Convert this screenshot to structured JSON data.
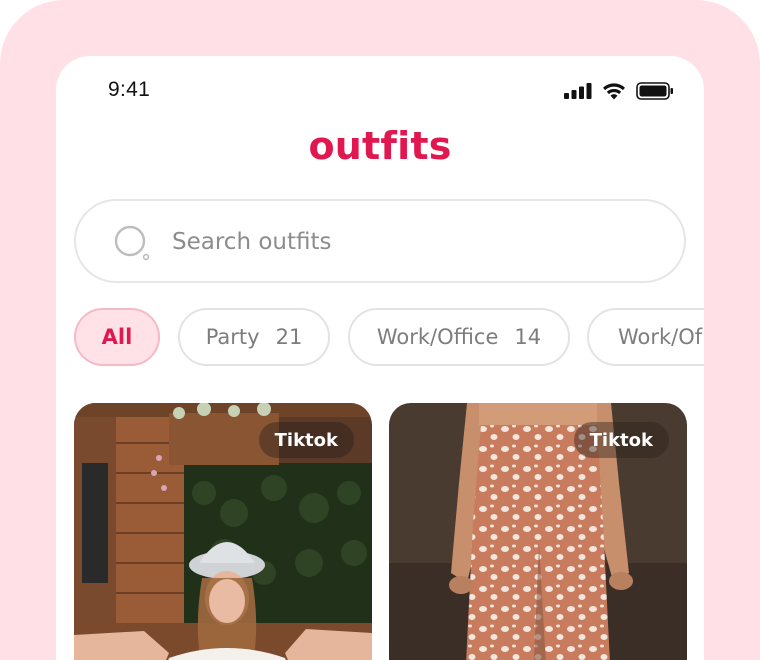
{
  "status_bar": {
    "time": "9:41"
  },
  "app": {
    "title": "outfits"
  },
  "search": {
    "placeholder": "Search outfits"
  },
  "filters": [
    {
      "label": "All",
      "count": "",
      "active": true
    },
    {
      "label": "Party",
      "count": "21",
      "active": false
    },
    {
      "label": "Work/Office",
      "count": "14",
      "active": false
    },
    {
      "label": "Work/Of",
      "count": "",
      "active": false
    }
  ],
  "outfits": [
    {
      "source": "Tiktok"
    },
    {
      "source": "Tiktok"
    }
  ],
  "colors": {
    "accent": "#e0184f",
    "background": "#ffe0e6",
    "chip_active_bg": "#ffe2e8"
  }
}
